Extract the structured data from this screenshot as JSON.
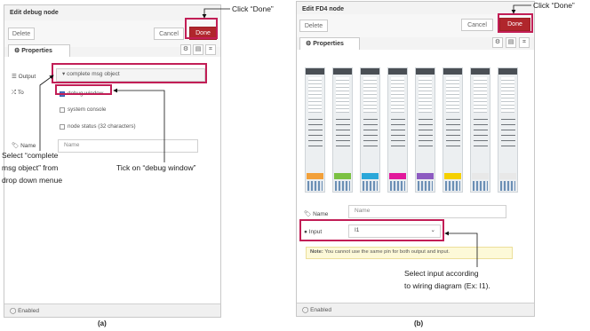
{
  "panel_a": {
    "title": "Edit debug node",
    "delete_label": "Delete",
    "cancel_label": "Cancel",
    "done_label": "Done",
    "tab_properties": "Properties",
    "output_label": "Output",
    "output_value": "complete msg object",
    "to_label": "To",
    "options": [
      {
        "label": "debug window",
        "checked": true
      },
      {
        "label": "system console",
        "checked": false
      },
      {
        "label": "node status (32 characters)",
        "checked": false
      }
    ],
    "name_label": "Name",
    "name_placeholder": "Name",
    "enabled_label": "Enabled",
    "caption": "(a)"
  },
  "panel_b": {
    "title": "Edit FD4 node",
    "delete_label": "Delete",
    "cancel_label": "Cancel",
    "done_label": "Done",
    "tab_properties": "Properties",
    "name_label": "Name",
    "name_placeholder": "Name",
    "input_label": "Input",
    "input_value": "I1",
    "note_bold": "Note:",
    "note_text": "You cannot use the same pin for both output and input.",
    "enabled_label": "Enabled",
    "caption": "(b)"
  },
  "annotations": {
    "click_done_a": "Click “Done”",
    "click_done_b": "Click “Done”",
    "select_msg": [
      "Select “complete",
      "msg object” from",
      "drop down menue"
    ],
    "tick_debug": "Tick on “debug window”",
    "select_input": [
      "Select input according",
      "to wiring diagram (Ex: I1)."
    ]
  },
  "colors": {
    "accent": "#b0262c",
    "highlight": "#c21e56",
    "module_bands": [
      "#f2a03a",
      "#7bc142",
      "#2aa7d9",
      "#e2189b",
      "#8d5bc1",
      "#f5d000",
      "#e8e8e8"
    ]
  }
}
